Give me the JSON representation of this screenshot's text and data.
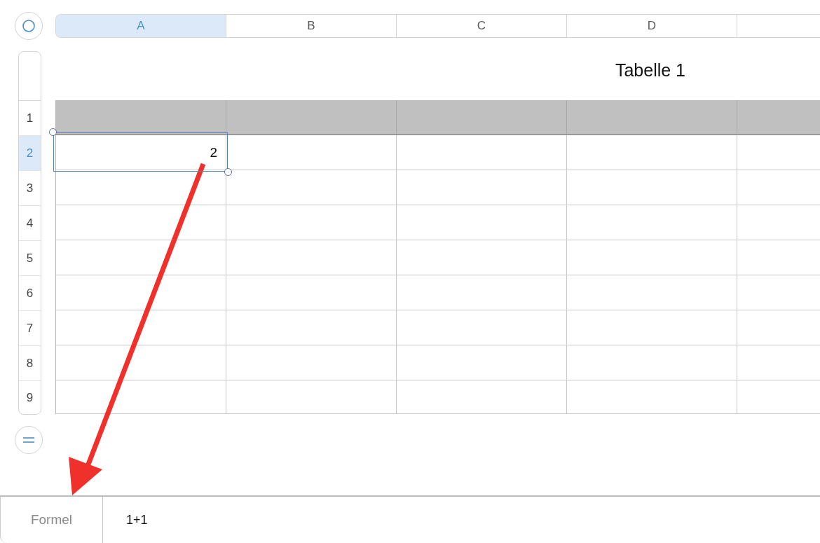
{
  "columns": [
    {
      "label": "A",
      "selected": true
    },
    {
      "label": "B",
      "selected": false
    },
    {
      "label": "C",
      "selected": false
    },
    {
      "label": "D",
      "selected": false
    }
  ],
  "table": {
    "title": "Tabelle 1",
    "rows": [
      {
        "label": "1",
        "kind": "header",
        "selected": false
      },
      {
        "label": "2",
        "kind": "body",
        "selected": true
      },
      {
        "label": "3",
        "kind": "body",
        "selected": false
      },
      {
        "label": "4",
        "kind": "body",
        "selected": false
      },
      {
        "label": "5",
        "kind": "body",
        "selected": false
      },
      {
        "label": "6",
        "kind": "body",
        "selected": false
      },
      {
        "label": "7",
        "kind": "body",
        "selected": false
      },
      {
        "label": "8",
        "kind": "body",
        "selected": false
      },
      {
        "label": "9",
        "kind": "body",
        "selected": false
      }
    ],
    "selected_cell": {
      "value": "2"
    }
  },
  "formula_bar": {
    "label": "Formel",
    "value": "1+1"
  }
}
